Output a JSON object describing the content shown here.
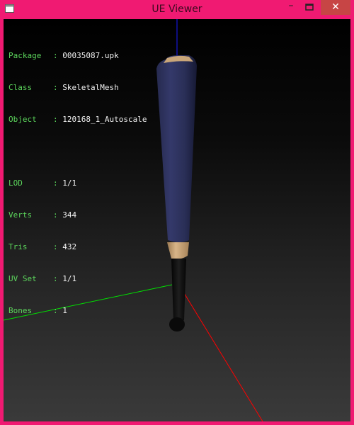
{
  "window": {
    "title": "UE Viewer",
    "buttons": {
      "minimize": "–",
      "close": "✕"
    }
  },
  "viewport": {
    "mesh_info": [
      {
        "label": "Package",
        "value": "00035087.upk"
      },
      {
        "label": "Class",
        "value": "SkeletalMesh"
      },
      {
        "label": "Object",
        "value": "120168_1_Autoscale"
      }
    ],
    "lod_info": [
      {
        "label": "LOD",
        "value": "1/1"
      },
      {
        "label": "Verts",
        "value": "344"
      },
      {
        "label": "Tris",
        "value": "432"
      },
      {
        "label": "UV Set",
        "value": "1/1"
      },
      {
        "label": "Bones",
        "value": "1"
      }
    ],
    "colors": {
      "label": "#5cd65c",
      "value": "#f2f2f2",
      "axis_x": "#ff0000",
      "axis_y": "#00e000",
      "axis_z": "#1a1aff",
      "blade": "#2a2f55",
      "guard": "#c8a479",
      "handle": "#0d0d0d"
    }
  }
}
